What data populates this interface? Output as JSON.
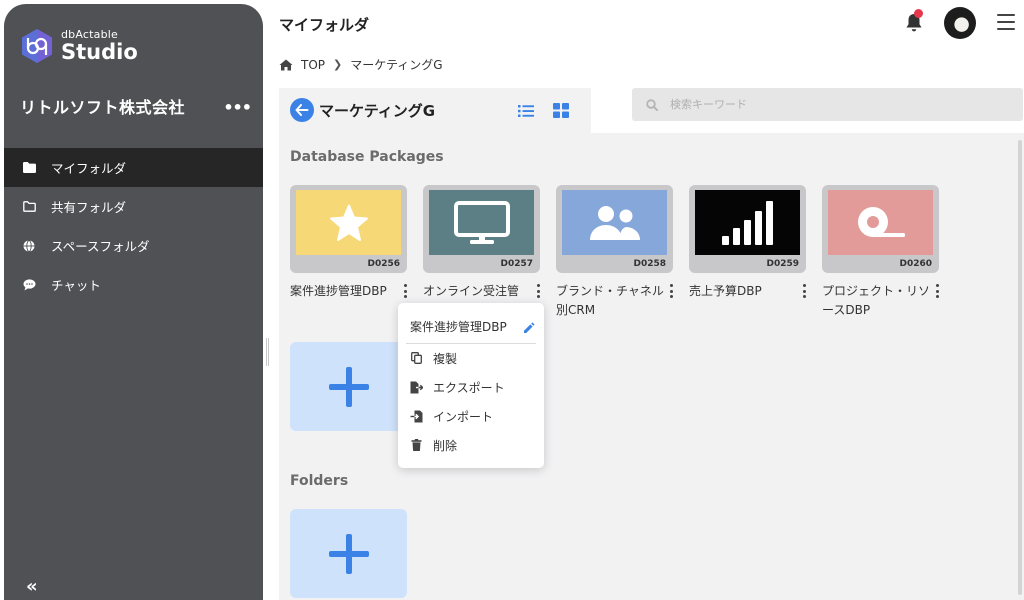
{
  "app": {
    "logo_small": "dbActable",
    "logo_big": "Studio",
    "company": "リトルソフト株式会社",
    "company_more": "•••",
    "collapse_label": "«"
  },
  "sidebar": {
    "items": [
      {
        "label": "マイフォルダ",
        "icon": "folder-solid-icon",
        "active": true
      },
      {
        "label": "共有フォルダ",
        "icon": "folder-outline-icon",
        "active": false
      },
      {
        "label": "スペースフォルダ",
        "icon": "globe-icon",
        "active": false
      },
      {
        "label": "チャット",
        "icon": "chat-bubble-icon",
        "active": false
      }
    ]
  },
  "header": {
    "title": "マイフォルダ",
    "has_notification": true
  },
  "breadcrumb": {
    "home": "TOP",
    "current": "マーケティングG"
  },
  "folder": {
    "name": "マーケティングG"
  },
  "search": {
    "placeholder": "検索キーワード",
    "value": ""
  },
  "sections": {
    "packages": "Database Packages",
    "folders": "Folders"
  },
  "packages": [
    {
      "code": "D0256",
      "label": "案件進捗管理DBP",
      "bg": "#f6d876",
      "icon": "star-icon"
    },
    {
      "code": "D0257",
      "label": "オンライン受注管",
      "bg": "#5b7f84",
      "icon": "monitor-icon"
    },
    {
      "code": "D0258",
      "label": "ブランド・チャネル別CRM",
      "bg": "#86a7da",
      "icon": "users-icon"
    },
    {
      "code": "D0259",
      "label": "売上予算DBP",
      "bg": "#050505",
      "icon": "signal-bars-icon"
    },
    {
      "code": "D0260",
      "label": "プロジェクト・リソースDBP",
      "bg": "#e29b99",
      "icon": "tape-icon"
    }
  ],
  "context_menu": {
    "title": "案件進捗管理DBP",
    "items": [
      {
        "label": "複製",
        "icon": "copy-icon"
      },
      {
        "label": "エクスポート",
        "icon": "export-icon"
      },
      {
        "label": "インポート",
        "icon": "import-icon"
      },
      {
        "label": "削除",
        "icon": "trash-icon"
      }
    ]
  },
  "colors": {
    "accent": "#3b82e6",
    "sidebar_bg": "#505154",
    "sidebar_active": "#262626",
    "add_tile": "#cfe2fb",
    "notification": "#e5384c"
  }
}
